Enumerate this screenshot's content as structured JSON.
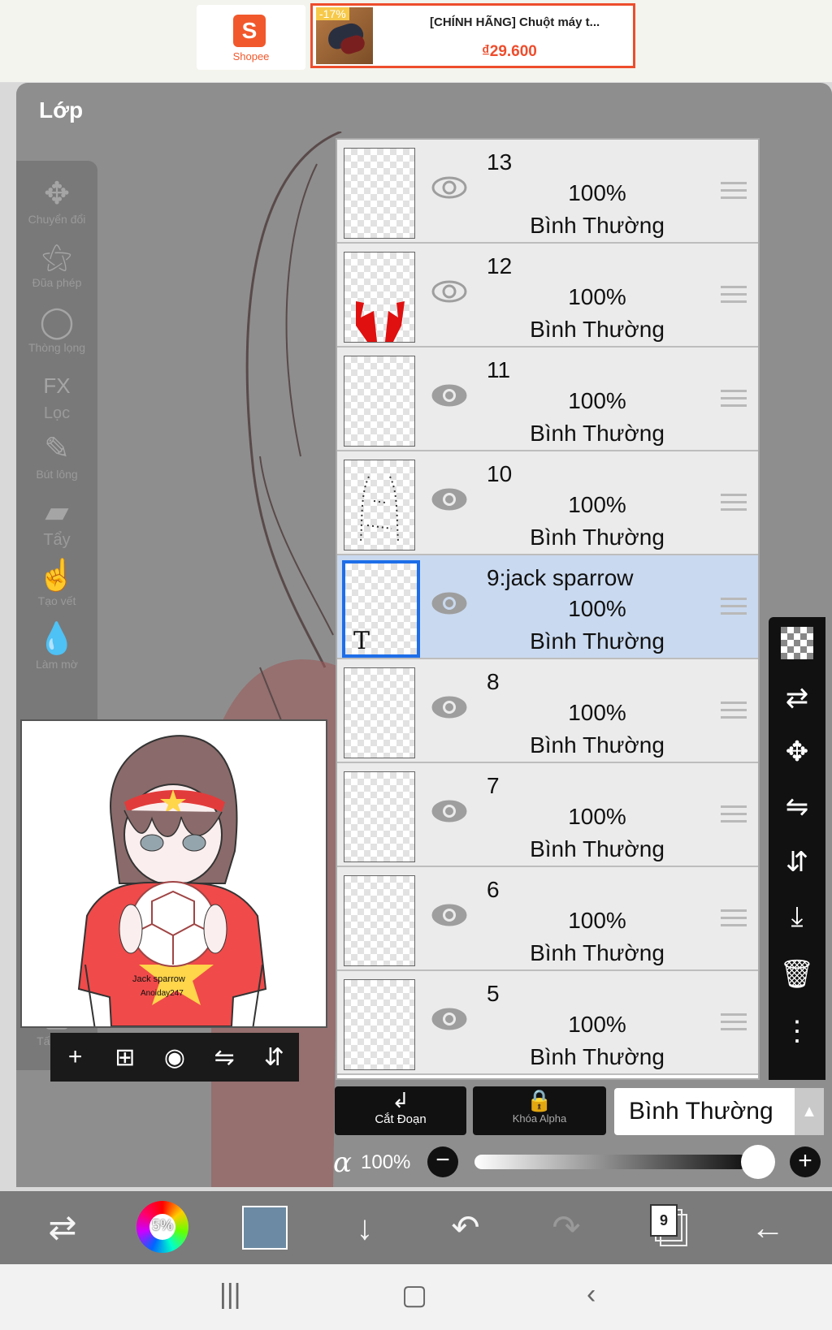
{
  "ad": {
    "brand": "Shopee",
    "discount": "-17%",
    "title": "[CHÍNH HÃNG] Chuột máy t...",
    "price": "₫29.600"
  },
  "panel": {
    "title": "Lớp"
  },
  "tools": [
    {
      "icon": "move-icon",
      "label": "Chuyển đổi"
    },
    {
      "icon": "magic-wand-icon",
      "label": "Đũa phép"
    },
    {
      "icon": "lasso-icon",
      "label": "Thòng lọng"
    },
    {
      "icon": "fx-icon",
      "label": "Lọc"
    },
    {
      "icon": "brush-icon",
      "label": "Bút lông"
    },
    {
      "icon": "eraser-icon",
      "label": "Tẩy"
    },
    {
      "icon": "smudge-icon",
      "label": "Tạo vết"
    },
    {
      "icon": "blur-icon",
      "label": "Làm mờ"
    },
    {
      "icon": "canvas-icon",
      "label": "Tấm vải"
    }
  ],
  "layers": [
    {
      "name": "13",
      "opacity": "100%",
      "blend": "Bình Thường",
      "visible": false,
      "selected": false
    },
    {
      "name": "12",
      "opacity": "100%",
      "blend": "Bình Thường",
      "visible": false,
      "selected": false
    },
    {
      "name": "11",
      "opacity": "100%",
      "blend": "Bình Thường",
      "visible": true,
      "selected": false
    },
    {
      "name": "10",
      "opacity": "100%",
      "blend": "Bình Thường",
      "visible": true,
      "selected": false
    },
    {
      "name": "9:jack sparrow",
      "opacity": "100%",
      "blend": "Bình Thường",
      "visible": true,
      "selected": true,
      "thumb_text": "T"
    },
    {
      "name": "8",
      "opacity": "100%",
      "blend": "Bình Thường",
      "visible": true,
      "selected": false
    },
    {
      "name": "7",
      "opacity": "100%",
      "blend": "Bình Thường",
      "visible": true,
      "selected": false
    },
    {
      "name": "6",
      "opacity": "100%",
      "blend": "Bình Thường",
      "visible": true,
      "selected": false
    },
    {
      "name": "5",
      "opacity": "100%",
      "blend": "Bình Thường",
      "visible": true,
      "selected": false
    }
  ],
  "preview": {
    "shirt_text": "Jack sparrow",
    "shirt_subtext": "Anoiday247"
  },
  "controls": {
    "clip_label": "Cắt Đoạn",
    "alpha_lock_label": "Khóa Alpha",
    "blend_mode": "Bình Thường",
    "alpha_symbol": "α",
    "opacity": "100%",
    "opacity_value": 1.0
  },
  "bottom": {
    "brush_size": "5%",
    "color": "#6c8aa3",
    "layer_count": "9"
  }
}
